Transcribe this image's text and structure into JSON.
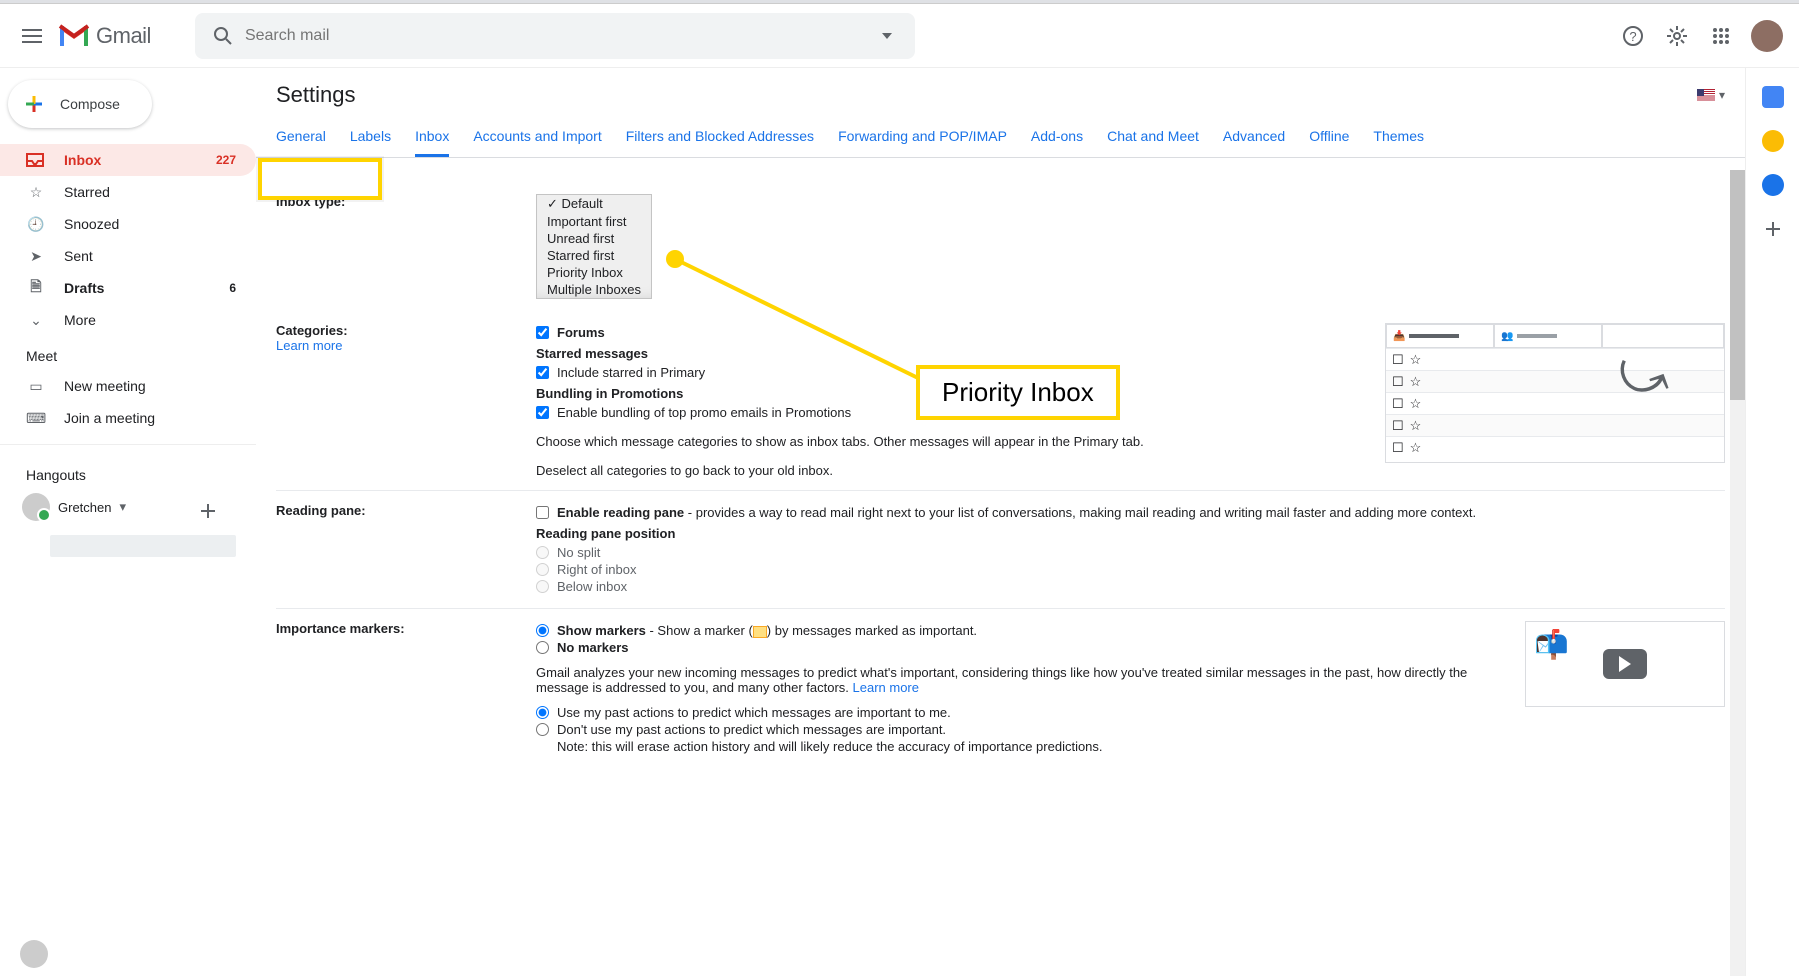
{
  "header": {
    "product_name": "Gmail",
    "search_placeholder": "Search mail"
  },
  "compose_label": "Compose",
  "nav": {
    "inbox": {
      "label": "Inbox",
      "count": "227"
    },
    "starred": {
      "label": "Starred"
    },
    "snoozed": {
      "label": "Snoozed"
    },
    "sent": {
      "label": "Sent"
    },
    "drafts": {
      "label": "Drafts",
      "count": "6"
    },
    "more": {
      "label": "More"
    }
  },
  "meet": {
    "heading": "Meet",
    "new": "New meeting",
    "join": "Join a meeting"
  },
  "hangouts": {
    "heading": "Hangouts",
    "user": "Gretchen"
  },
  "settings": {
    "title": "Settings",
    "tabs": {
      "general": "General",
      "labels": "Labels",
      "inbox": "Inbox",
      "accounts": "Accounts and Import",
      "filters": "Filters and Blocked Addresses",
      "forwarding": "Forwarding and POP/IMAP",
      "addons": "Add-ons",
      "chat": "Chat and Meet",
      "advanced": "Advanced",
      "offline": "Offline",
      "themes": "Themes"
    },
    "inbox_type": {
      "label": "Inbox type:",
      "options": {
        "default": "Default",
        "important_first": "Important first",
        "unread_first": "Unread first",
        "starred_first": "Starred first",
        "priority": "Priority Inbox",
        "multiple": "Multiple Inboxes"
      }
    },
    "categories": {
      "label": "Categories:",
      "learn_more": "Learn more",
      "forums": "Forums"
    },
    "starred_msgs": {
      "heading": "Starred messages",
      "include": "Include starred in Primary"
    },
    "bundling": {
      "heading": "Bundling in Promotions",
      "enable": "Enable bundling of top promo emails in Promotions"
    },
    "categories_help1": "Choose which message categories to show as inbox tabs. Other messages will appear in the Primary tab.",
    "categories_help2": "Deselect all categories to go back to your old inbox.",
    "reading_pane": {
      "label": "Reading pane:",
      "enable_lead": "Enable reading pane",
      "enable_rest": " - provides a way to read mail right next to your list of conversations, making mail reading and writing mail faster and adding more context.",
      "position_heading": "Reading pane position",
      "no_split": "No split",
      "right": "Right of inbox",
      "below": "Below inbox"
    },
    "importance": {
      "label": "Importance markers:",
      "show_lead": "Show markers",
      "show_rest_a": " - Show a marker (",
      "show_rest_b": ") by messages marked as important.",
      "no_markers": "No markers",
      "analyze": "Gmail analyzes your new incoming messages to predict what's important, considering things like how you've treated similar messages in the past, how directly the message is addressed to you, and many other factors. ",
      "learn_more": "Learn more",
      "use_past": "Use my past actions to predict which messages are important to me.",
      "dont_use": "Don't use my past actions to predict which messages are important.",
      "note": "Note: this will erase action history and will likely reduce the accuracy of importance predictions."
    }
  },
  "annotation": {
    "callout": "Priority Inbox"
  }
}
